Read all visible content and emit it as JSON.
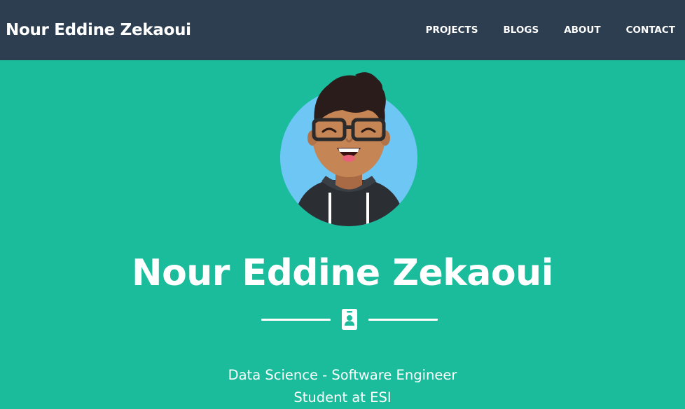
{
  "navbar": {
    "brand": "Nour Eddine Zekaoui",
    "links": [
      "PROJECTS",
      "BLOGS",
      "ABOUT",
      "CONTACT"
    ]
  },
  "masthead": {
    "heading": "Nour Eddine Zekaoui",
    "divider_icon": "id-badge-icon",
    "subheading_lines": [
      "Data Science - Software Engineer",
      "Student at ESI"
    ]
  },
  "colors": {
    "navbar_bg": "#2c3e50",
    "masthead_bg": "#1abc9c",
    "avatar_circle": "#6ec6f5",
    "text": "#ffffff"
  }
}
